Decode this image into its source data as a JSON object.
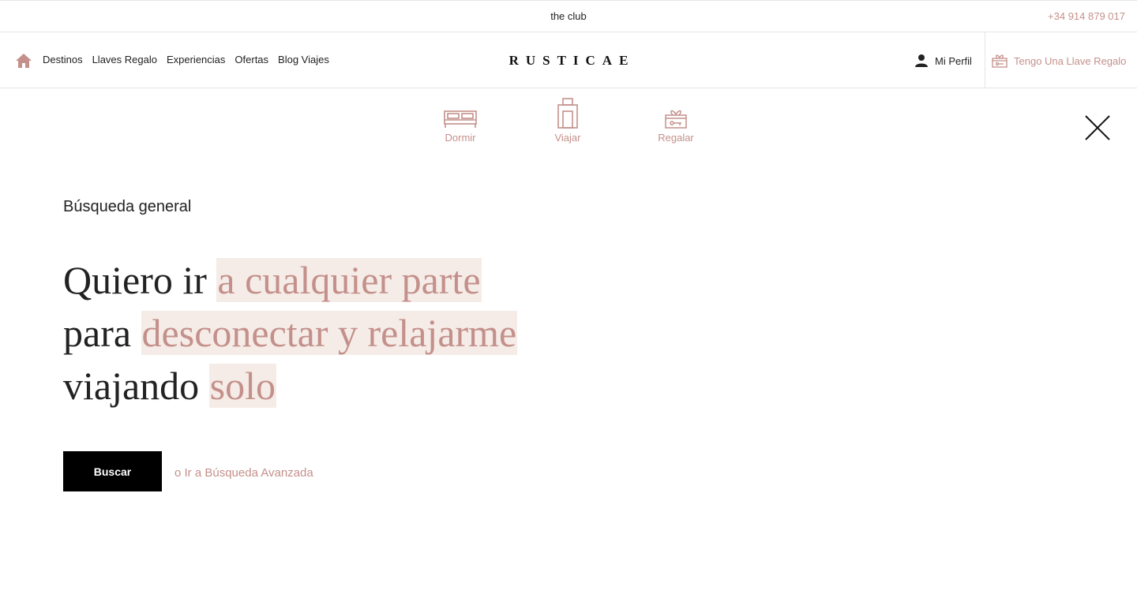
{
  "topbar": {
    "club": "the club",
    "phone": "+34 914 879 017"
  },
  "nav": {
    "home_icon": "home-icon",
    "links": [
      "Destinos",
      "Llaves Regalo",
      "Experiencias",
      "Ofertas",
      "Blog Viajes"
    ],
    "logo": "RUSTICAE",
    "profile": "Mi Perfil",
    "gift_key": "Tengo Una Llave Regalo"
  },
  "categories": [
    {
      "label": "Dormir",
      "icon": "bed-icon"
    },
    {
      "label": "Viajar",
      "icon": "suitcase-icon"
    },
    {
      "label": "Regalar",
      "icon": "gift-icon"
    }
  ],
  "search": {
    "title": "Búsqueda general",
    "line1_prefix": "Quiero ir",
    "line1_value": "a cualquier parte",
    "line2_prefix": "para",
    "line2_value": "desconectar y relajarme",
    "line3_prefix": "viajando",
    "line3_value": "solo",
    "button": "Buscar",
    "advanced_link": "o Ir a Búsqueda Avanzada"
  },
  "colors": {
    "accent": "#c4908b",
    "highlight_bg": "#f5ece7",
    "text": "#222222"
  }
}
